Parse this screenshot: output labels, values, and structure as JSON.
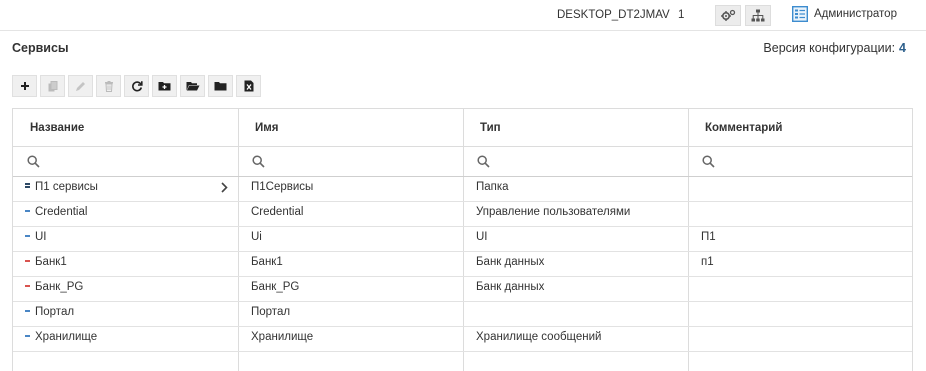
{
  "topbar": {
    "host": "DESKTOP_DT2JMAV",
    "count": "1",
    "user": "Администратор",
    "icons": [
      "gear-icon",
      "hierarchy-icon",
      "user-card-icon"
    ]
  },
  "page": {
    "title": "Сервисы",
    "version_label": "Версия конфигурации:",
    "version_value": "4"
  },
  "toolbar": {
    "buttons": [
      "add",
      "copy",
      "edit",
      "delete",
      "refresh",
      "add-folder",
      "open-folder",
      "folder",
      "export-excel"
    ]
  },
  "grid": {
    "columns": [
      "Название",
      "Имя",
      "Тип",
      "Комментарий"
    ],
    "rows": [
      {
        "name": "П1 сервисы",
        "id": "П1Сервисы",
        "type": "Папка",
        "comment": "",
        "status": "folder",
        "expandable": true
      },
      {
        "name": "Credential",
        "id": "Credential",
        "type": "Управление пользователями",
        "comment": "",
        "status": "running"
      },
      {
        "name": "UI",
        "id": "Ui",
        "type": "UI",
        "comment": "П1",
        "status": "running"
      },
      {
        "name": "Банк1",
        "id": "Банк1",
        "type": "Банк данных",
        "comment": "п1",
        "status": "stopped"
      },
      {
        "name": "Банк_PG",
        "id": "Банк_PG",
        "type": "Банк данных",
        "comment": "",
        "status": "stopped"
      },
      {
        "name": "Портал",
        "id": "Портал",
        "type": "",
        "comment": "",
        "status": "running"
      },
      {
        "name": "Хранилище",
        "id": "Хранилище",
        "type": "Хранилище сообщений",
        "comment": "",
        "status": "running"
      }
    ]
  },
  "colors": {
    "running": "#4a86c5",
    "stopped": "#d9534f",
    "folder": "#2e4a66",
    "version_accent": "#2d5f8b"
  }
}
